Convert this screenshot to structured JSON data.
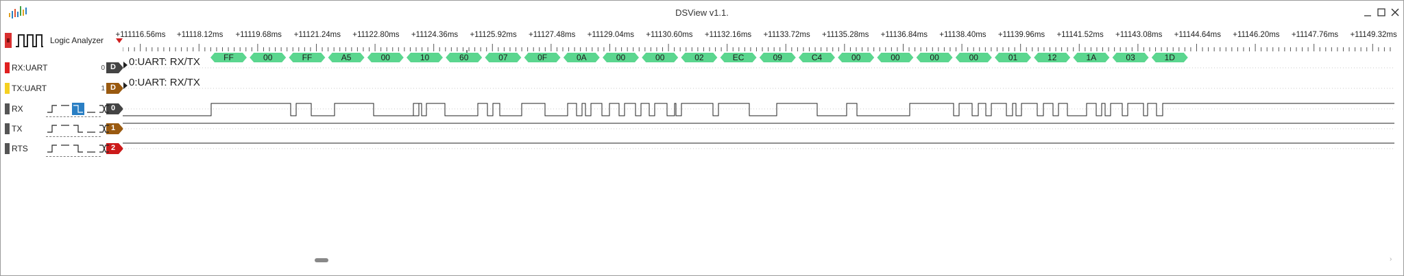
{
  "window": {
    "title": "DSView v1.1."
  },
  "device": {
    "label": "Logic Analyzer",
    "logo": "logic-analyzer-wave-icon"
  },
  "ruler": {
    "labels": [
      "+111116.56ms",
      "+11118.12ms",
      "+11119.68ms",
      "+11121.24ms",
      "+11122.80ms",
      "+11124.36ms",
      "+11125.92ms",
      "+11127.48ms",
      "+11129.04ms",
      "+11130.60ms",
      "+11132.16ms",
      "+11133.72ms",
      "+11135.28ms",
      "+11136.84ms",
      "+11138.40ms",
      "+11139.96ms",
      "+11141.52ms",
      "+11143.08ms",
      "+11144.64ms",
      "+11146.20ms",
      "+11147.76ms",
      "+11149.32ms"
    ]
  },
  "channels": [
    {
      "name": "RX:UART",
      "index": "0",
      "tag": "D",
      "color": "#e02020",
      "tag_color": "#444444",
      "type": "decoder",
      "decoder_title": "0:UART: RX/TX"
    },
    {
      "name": "TX:UART",
      "index": "1",
      "tag": "D",
      "color": "#f5d020",
      "tag_color": "#9a5a10",
      "type": "decoder",
      "decoder_title": "0:UART: RX/TX"
    },
    {
      "name": "RX",
      "index": "",
      "tag": "0",
      "color": "#555555",
      "tag_color": "#444444",
      "type": "logic"
    },
    {
      "name": "TX",
      "index": "",
      "tag": "1",
      "color": "#555555",
      "tag_color": "#9a5a10",
      "type": "logic"
    },
    {
      "name": "RTS",
      "index": "",
      "tag": "2",
      "color": "#555555",
      "tag_color": "#cc1a1a",
      "type": "logic"
    }
  ],
  "decoded_bytes": [
    "FF",
    "00",
    "FF",
    "A5",
    "00",
    "10",
    "60",
    "07",
    "0F",
    "0A",
    "00",
    "00",
    "02",
    "EC",
    "09",
    "C4",
    "00",
    "00",
    "00",
    "00",
    "01",
    "12",
    "1A",
    "03",
    "1D"
  ],
  "colors": {
    "decode_fill": "#5bd68f",
    "grid_line": "#c8c8c8",
    "trigger_selected": "#2a7fc4"
  }
}
